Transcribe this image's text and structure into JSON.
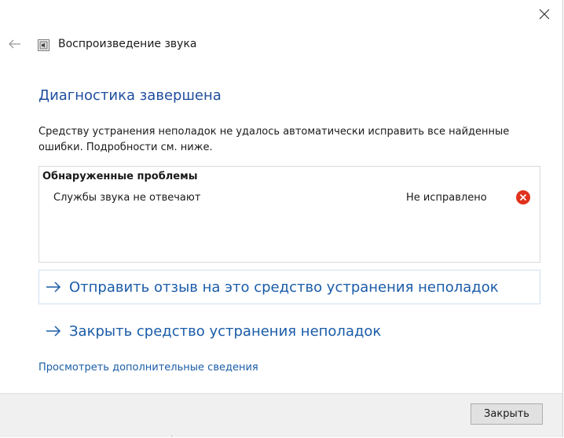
{
  "window": {
    "title": "Воспроизведение звука"
  },
  "heading": "Диагностика завершена",
  "description": "Средству устранения неполадок не удалось автоматически исправить все найденные ошибки. Подробности см. ниже.",
  "problems": {
    "header": "Обнаруженные проблемы",
    "items": [
      {
        "name": "Службы звука не отвечают",
        "status": "Не исправлено",
        "status_icon": "error-icon"
      }
    ]
  },
  "commands": {
    "feedback": "Отправить отзыв на это средство устранения неполадок",
    "close": "Закрыть средство устранения неполадок"
  },
  "more_info_link": "Просмотреть дополнительные сведения",
  "footer": {
    "close_button": "Закрыть"
  },
  "colors": {
    "heading": "#1f4e9e",
    "link": "#1a5ca8",
    "error": "#e0321c"
  }
}
